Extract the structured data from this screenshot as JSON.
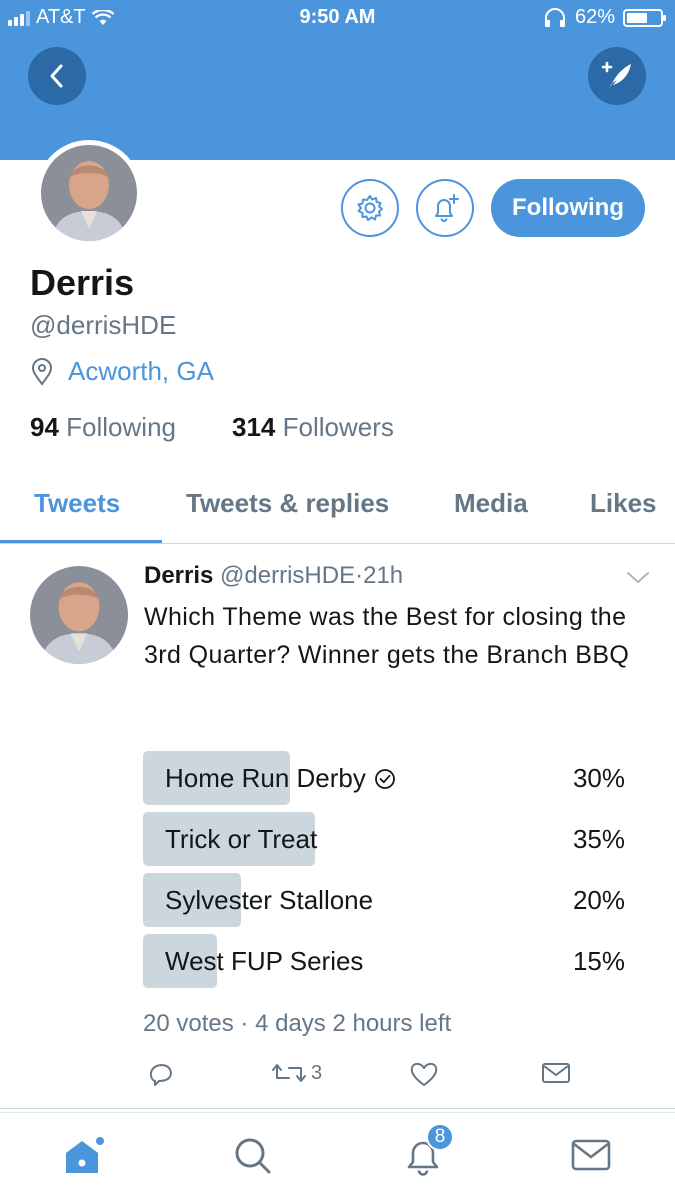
{
  "status_bar": {
    "carrier": "AT&T",
    "time": "9:50 AM",
    "battery": "62%",
    "battery_level": 0.62
  },
  "header": {
    "back_icon": "chevron-left-icon",
    "compose_icon": "compose-tweet-icon"
  },
  "profile": {
    "name": "Derris",
    "handle": "@derrisHDE",
    "location": "Acworth, GA",
    "following_count": "94",
    "following_label": "Following",
    "followers_count": "314",
    "followers_label": "Followers",
    "follow_button": "Following"
  },
  "tabs": [
    {
      "label": "Tweets",
      "active": true
    },
    {
      "label": "Tweets & replies",
      "active": false
    },
    {
      "label": "Media",
      "active": false
    },
    {
      "label": "Likes",
      "active": false
    }
  ],
  "tweet": {
    "author": "Derris",
    "handle": "@derrisHDE",
    "separator": "·",
    "time": "21h",
    "text": "Which Theme was the Best for closing the 3rd Quarter? Winner gets the Branch BBQ",
    "poll": {
      "options": [
        {
          "label": "Home Run Derby",
          "percent": "30%",
          "value": 30,
          "voted": true
        },
        {
          "label": "Trick or Treat",
          "percent": "35%",
          "value": 35,
          "voted": false
        },
        {
          "label": "Sylvester Stallone",
          "percent": "20%",
          "value": 20,
          "voted": false
        },
        {
          "label": "West FUP Series",
          "percent": "15%",
          "value": 15,
          "voted": false
        }
      ],
      "votes": "20 votes",
      "meta_separator": "·",
      "time_left": "4 days 2 hours left"
    },
    "retweet_count": "3"
  },
  "bottom_nav": {
    "notifications_badge": "8"
  },
  "colors": {
    "accent": "#4a95dc",
    "banner": "#4a95dc",
    "poll_bar": "#ccd6dd",
    "muted": "#657786"
  }
}
